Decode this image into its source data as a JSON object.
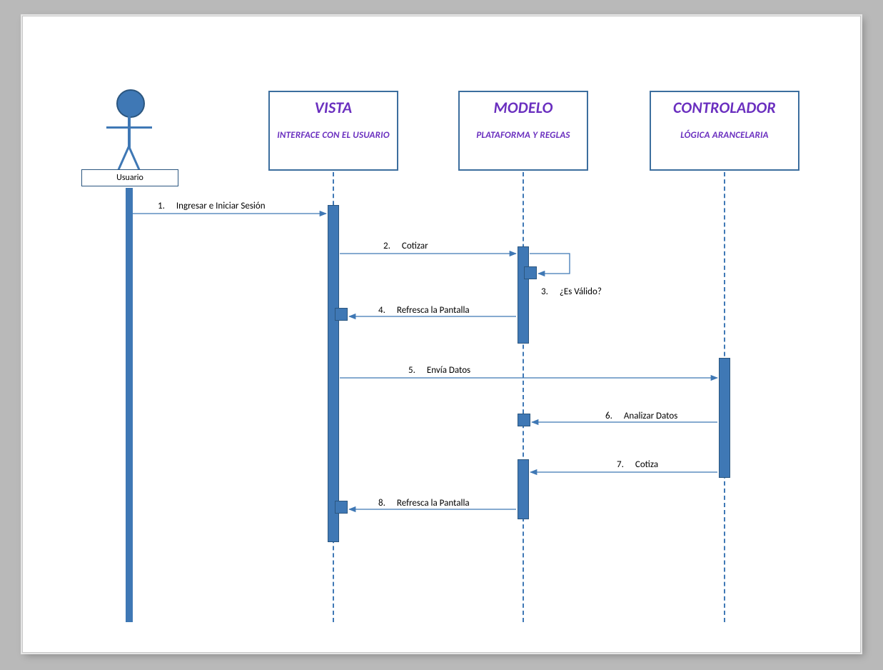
{
  "actor": {
    "label": "Usuario"
  },
  "participants": {
    "vista": {
      "title": "VISTA",
      "subtitle": "INTERFACE CON EL USUARIO"
    },
    "modelo": {
      "title": "MODELO",
      "subtitle": "PLATAFORMA Y REGLAS"
    },
    "controlador": {
      "title": "CONTROLADOR",
      "subtitle": "LÓGICA ARANCELARIA"
    }
  },
  "messages": {
    "m1": {
      "num": "1.",
      "text": "Ingresar e Iniciar Sesión"
    },
    "m2": {
      "num": "2.",
      "text": "Cotizar"
    },
    "m3": {
      "num": "3.",
      "text": "¿Es Válido?"
    },
    "m4": {
      "num": "4.",
      "text": "Refresca la Pantalla"
    },
    "m5": {
      "num": "5.",
      "text": "Envía Datos"
    },
    "m6": {
      "num": "6.",
      "text": "Analizar Datos"
    },
    "m7": {
      "num": "7.",
      "text": "Cotiza"
    },
    "m8": {
      "num": "8.",
      "text": "Refresca la Pantalla"
    }
  }
}
